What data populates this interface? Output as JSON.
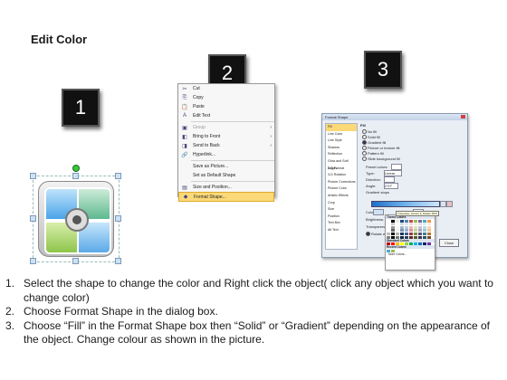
{
  "title": "Edit Color",
  "badges": [
    "1",
    "2",
    "3"
  ],
  "context_menu": {
    "items": [
      {
        "label": "Cut",
        "icon": "scissors-icon",
        "glyph": "✂",
        "has_submenu": false,
        "disabled": false
      },
      {
        "label": "Copy",
        "icon": "copy-icon",
        "glyph": "⎘",
        "has_submenu": false,
        "disabled": false
      },
      {
        "label": "Paste",
        "icon": "paste-icon",
        "glyph": "📋",
        "has_submenu": false,
        "disabled": false
      },
      {
        "label": "Edit Text",
        "icon": "edit-text-icon",
        "glyph": "A",
        "has_submenu": false,
        "disabled": false
      },
      {
        "label": "Group",
        "icon": "group-icon",
        "glyph": "▣",
        "has_submenu": true,
        "disabled": true
      },
      {
        "label": "Bring to Front",
        "icon": "bring-front-icon",
        "glyph": "◧",
        "has_submenu": true,
        "disabled": false
      },
      {
        "label": "Send to Back",
        "icon": "send-back-icon",
        "glyph": "◨",
        "has_submenu": true,
        "disabled": false
      },
      {
        "label": "Hyperlink...",
        "icon": "hyperlink-icon",
        "glyph": "🔗",
        "has_submenu": false,
        "disabled": false
      },
      {
        "label": "Save as Picture...",
        "icon": "",
        "glyph": "",
        "has_submenu": false,
        "disabled": false
      },
      {
        "label": "Set as Default Shape",
        "icon": "",
        "glyph": "",
        "has_submenu": false,
        "disabled": false
      },
      {
        "label": "Size and Position...",
        "icon": "size-icon",
        "glyph": "▤",
        "has_submenu": false,
        "disabled": false
      },
      {
        "label": "Format Shape...",
        "icon": "format-shape-icon",
        "glyph": "◆",
        "has_submenu": false,
        "disabled": false,
        "highlighted": true
      }
    ],
    "submenu_glyph": "›"
  },
  "format_dialog": {
    "title": "Format Shape",
    "categories": [
      "Fill",
      "Line Color",
      "Line Style",
      "Shadow",
      "Reflection",
      "Glow and Soft Edges",
      "3-D Format",
      "3-D Rotation",
      "Picture Corrections",
      "Picture Color",
      "Artistic Effects",
      "Crop",
      "Size",
      "Position",
      "Text Box",
      "Alt Text"
    ],
    "active_category": "Fill",
    "section_title": "Fill",
    "fill_options": [
      "No fill",
      "Solid fill",
      "Gradient fill",
      "Picture or texture fill",
      "Pattern fill",
      "Slide background fill"
    ],
    "selected_fill": "Gradient fill",
    "fields": {
      "preset_colors": "Preset colors:",
      "type_label": "Type:",
      "type_value": "Linear",
      "direction_label": "Direction:",
      "angle_label": "Angle:",
      "angle_value": "270°",
      "gradient_stops": "Gradient stops",
      "color_label": "Color",
      "position_label": "Position:",
      "position_value": "0%",
      "brightness_label": "Brightness:",
      "transparency_label": "Transparency:",
      "rotate_label": "Rotate with shape"
    },
    "close_label": "Close"
  },
  "color_picker": {
    "theme_label": "Theme Colors",
    "standard_label": "Standard Colors",
    "recent_label": "Recent Colors",
    "more_label": "More Colors...",
    "tooltip": "Turquoise, Accent 3, Darker 50%",
    "theme_top": [
      "#ffffff",
      "#000000",
      "#eeece1",
      "#1f497d",
      "#4f81bd",
      "#c0504d",
      "#9bbb59",
      "#8064a2",
      "#4bacc6",
      "#f79646"
    ],
    "standard": [
      "#c00000",
      "#ff0000",
      "#ffc000",
      "#ffff00",
      "#92d050",
      "#00b050",
      "#00b0f0",
      "#0070c0",
      "#002060",
      "#7030a0"
    ],
    "recent": [
      "#4bacc6",
      "#9bbb59"
    ]
  },
  "instructions": [
    {
      "num": "1.",
      "text": "Select the shape to change the color and Right click the object( click any object which you want to change color)"
    },
    {
      "num": "2.",
      "text": "Choose Format Shape in the dialog box."
    },
    {
      "num": "3.",
      "text": "Choose “Fill” in the Format Shape box then “Solid” or “Gradient” depending on the appearance of the object. Change colour as shown in the picture."
    }
  ]
}
